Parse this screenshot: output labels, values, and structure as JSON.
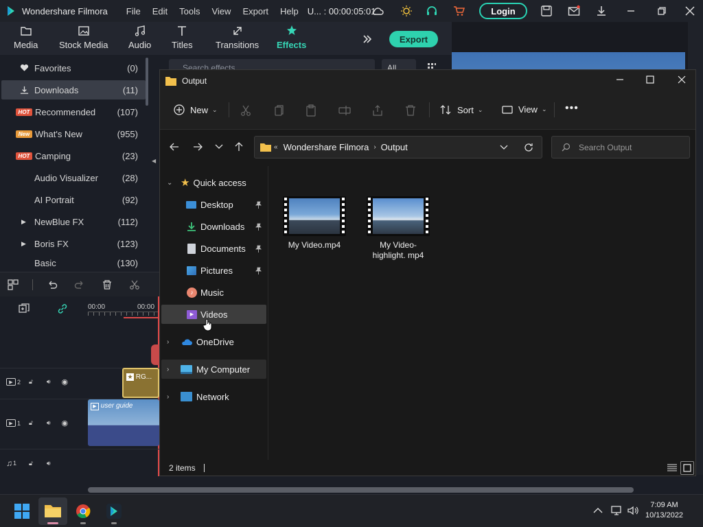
{
  "app": {
    "name": "Wondershare Filmora",
    "menus": [
      "File",
      "Edit",
      "Tools",
      "View",
      "Export",
      "Help"
    ],
    "project_time": "U... : 00:00:05:01",
    "login_label": "Login",
    "export_label": "Export"
  },
  "toolbar": {
    "tabs": [
      "Media",
      "Stock Media",
      "Audio",
      "Titles",
      "Transitions",
      "Effects"
    ],
    "active": "Effects"
  },
  "library": {
    "items": [
      {
        "label": "Favorites",
        "count": "(0)",
        "badge": ""
      },
      {
        "label": "Downloads",
        "count": "(11)",
        "badge": ""
      },
      {
        "label": "Recommended",
        "count": "(107)",
        "badge": "HOT"
      },
      {
        "label": "What's New",
        "count": "(955)",
        "badge": "New"
      },
      {
        "label": "Camping",
        "count": "(23)",
        "badge": "HOT"
      },
      {
        "label": "Audio Visualizer",
        "count": "(28)",
        "badge": ""
      },
      {
        "label": "AI Portrait",
        "count": "(92)",
        "badge": ""
      },
      {
        "label": "NewBlue FX",
        "count": "(112)",
        "badge": ""
      },
      {
        "label": "Boris FX",
        "count": "(123)",
        "badge": ""
      },
      {
        "label": "Basic",
        "count": "(130)",
        "badge": ""
      }
    ],
    "search_placeholder": "Search effects",
    "filter": "All"
  },
  "timeline": {
    "time_start": "00:00",
    "time_next": "00:00",
    "clip_effect": "RG...",
    "clip_video": "user guide",
    "tracks": [
      "2",
      "1",
      "1"
    ]
  },
  "explorer": {
    "title": "Output",
    "cmd": {
      "new": "New",
      "sort": "Sort",
      "view": "View"
    },
    "breadcrumb": [
      "Wondershare Filmora",
      "Output"
    ],
    "search_placeholder": "Search Output",
    "nav": {
      "quick_access": "Quick access",
      "items": [
        "Desktop",
        "Downloads",
        "Documents",
        "Pictures",
        "Music",
        "Videos"
      ],
      "onedrive": "OneDrive",
      "computer": "My Computer",
      "network": "Network"
    },
    "files": [
      "My Video.mp4",
      "My Video-highlight. mp4"
    ],
    "status": "2 items"
  },
  "taskbar": {
    "time": "7:09 AM",
    "date": "10/13/2022"
  },
  "colors": {
    "accent": "#2ed1ae",
    "folder": "#f2c04c"
  }
}
